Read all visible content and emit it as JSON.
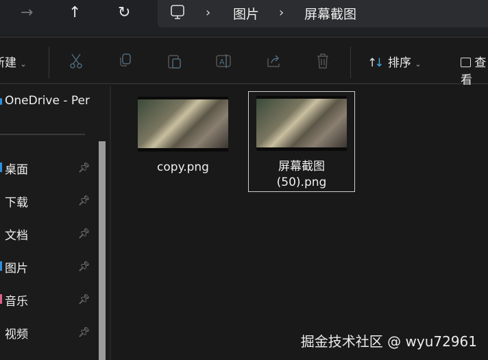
{
  "nav": {
    "forward": "→",
    "up": "↑",
    "refresh": "↻"
  },
  "breadcrumb": {
    "items": [
      "图片",
      "屏幕截图"
    ],
    "separator": "›"
  },
  "toolbar": {
    "new_label": "新建",
    "sort_label": "排序",
    "view_label": "查看"
  },
  "sidebar": {
    "onedrive": "OneDrive - Per",
    "items": [
      {
        "label": "桌面",
        "color": "#2f8fe0"
      },
      {
        "label": "下载",
        "color": ""
      },
      {
        "label": "文档",
        "color": ""
      },
      {
        "label": "图片",
        "color": "#2f8fe0"
      },
      {
        "label": "音乐",
        "color": "#e06090"
      },
      {
        "label": "视频",
        "color": ""
      }
    ]
  },
  "files": [
    {
      "name": "copy.png",
      "selected": false
    },
    {
      "name_line1": "屏幕截图",
      "name_line2": "(50).png",
      "selected": true
    }
  ],
  "watermark": "掘金技术社区 @ wyu72961"
}
